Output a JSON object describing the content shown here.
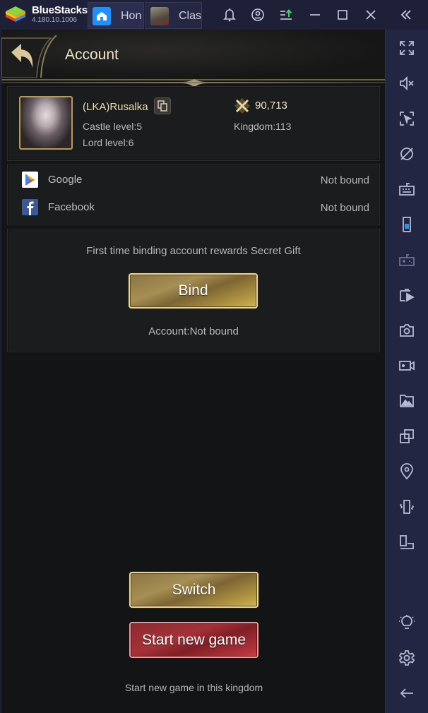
{
  "window": {
    "brand": "BlueStacks",
    "version": "4.180.10.1006",
    "tabs": [
      {
        "label": "Hon",
        "icon": "home-icon"
      },
      {
        "label": "Clas",
        "icon": "game-thumbnail-icon"
      }
    ],
    "controls": [
      "bell-icon",
      "account-icon",
      "update-icon",
      "minimize-icon",
      "maximize-icon",
      "close-icon",
      "collapse-sidebar-icon"
    ]
  },
  "sidebar": {
    "items": [
      {
        "name": "fullscreen-icon"
      },
      {
        "name": "mute-icon"
      },
      {
        "name": "pointer-lock-icon"
      },
      {
        "name": "eco-mode-icon"
      },
      {
        "name": "keyboard-icon"
      },
      {
        "name": "phone-icon"
      },
      {
        "name": "gamepad-icon"
      },
      {
        "name": "media-manager-icon"
      },
      {
        "name": "screenshot-icon"
      },
      {
        "name": "record-icon"
      },
      {
        "name": "gallery-icon"
      },
      {
        "name": "multi-instance-icon"
      },
      {
        "name": "location-icon"
      },
      {
        "name": "shake-icon"
      },
      {
        "name": "rotate-icon"
      },
      {
        "name": "lightbulb-icon"
      },
      {
        "name": "settings-icon"
      },
      {
        "name": "back-icon"
      }
    ]
  },
  "header": {
    "title": "Account"
  },
  "profile": {
    "name": "(LKA)Rusalka",
    "castle_level": "Castle level:5",
    "lord_level": "Lord level:6",
    "power": "90,713",
    "kingdom": "Kingdom:113"
  },
  "bindings": [
    {
      "name": "Google",
      "status": "Not bound",
      "icon": "google-play-icon"
    },
    {
      "name": "Facebook",
      "status": "Not bound",
      "icon": "facebook-icon"
    }
  ],
  "reward": {
    "text": "First time binding account rewards Secret Gift",
    "bind_label": "Bind",
    "account_status": "Account:Not bound"
  },
  "actions": {
    "switch_label": "Switch",
    "new_game_label": "Start new game",
    "new_game_hint": "Start new game in this kingdom"
  },
  "colors": {
    "accent_gold": "#e9d79a",
    "accent_red": "#a33238",
    "title_text": "#efe4c6"
  }
}
